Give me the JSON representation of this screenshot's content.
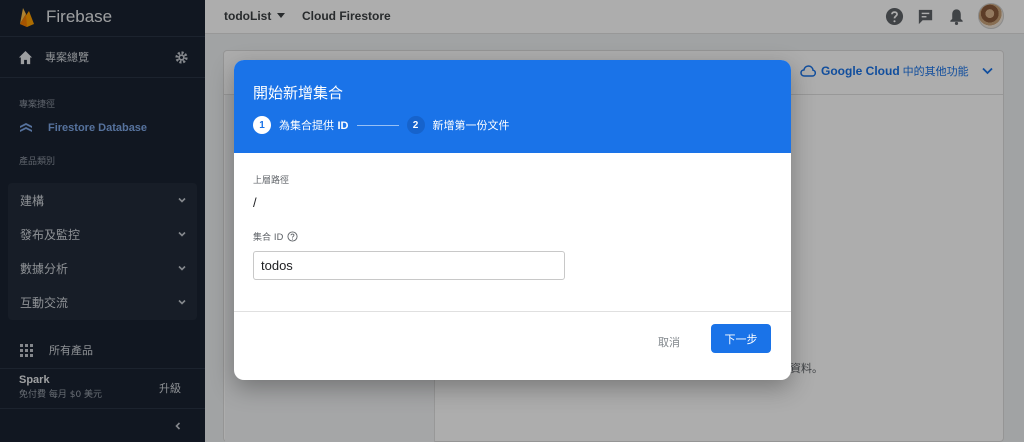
{
  "app": {
    "brand": "Firebase",
    "project": "todoList",
    "breadcrumb": "Cloud Firestore"
  },
  "sidebar": {
    "overview_label": "專案總覽",
    "shortcuts_section": "專案捷徑",
    "shortcut_item": "Firestore Database",
    "categories_section": "產品類別",
    "categories": [
      {
        "label": "建構"
      },
      {
        "label": "發布及監控"
      },
      {
        "label": "數據分析"
      },
      {
        "label": "互動交流"
      }
    ],
    "all_products": "所有產品",
    "plan_name": "Spark",
    "plan_desc": "免付費 每月 $0 美元",
    "upgrade": "升級"
  },
  "background": {
    "gcloud_bold": "Google Cloud",
    "gcloud_rest": "中的其他功能",
    "partial_text": "資料。"
  },
  "dialog": {
    "title": "開始新增集合",
    "steps": [
      {
        "num": "1",
        "label": "為集合提供 ID",
        "label_main": "為集合提供",
        "label_suffix": "ID",
        "active": true
      },
      {
        "num": "2",
        "label": "新增第一份文件",
        "active": false
      }
    ],
    "parent_path_label": "上層路徑",
    "parent_path_value": "/",
    "collection_id_label": "集合 ID",
    "collection_id_value": "todos",
    "cancel_label": "取消",
    "next_label": "下一步"
  },
  "colors": {
    "sidebar_bg": "#1a2331",
    "accent": "#1a73e8",
    "firebase_flame": "#ffa000"
  },
  "icons": [
    "firebase-logo",
    "home-icon",
    "gear-icon",
    "firestore-icon",
    "chevron-down-icon",
    "grid-icon",
    "chevron-left-icon",
    "help-icon",
    "feedback-icon",
    "notification-icon",
    "cloud-icon",
    "help-outline-icon"
  ]
}
